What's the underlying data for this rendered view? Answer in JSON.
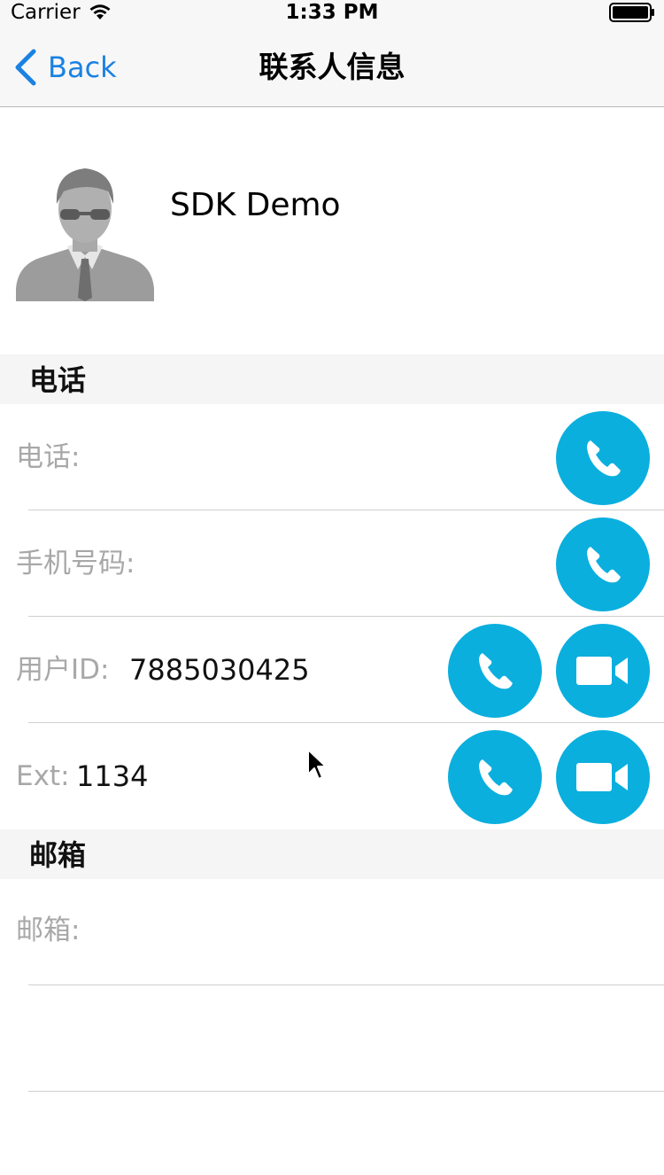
{
  "status_bar": {
    "carrier": "Carrier",
    "time": "1:33 PM"
  },
  "nav": {
    "back_label": "Back",
    "title": "联系人信息"
  },
  "profile": {
    "name": "SDK Demo",
    "avatar_icon": "person-avatar-icon"
  },
  "sections": {
    "phone_header": "电话",
    "email_header": "邮箱"
  },
  "rows": {
    "phone": {
      "label": "电话:",
      "value": ""
    },
    "mobile": {
      "label": "手机号码:",
      "value": ""
    },
    "user_id": {
      "label": "用户ID:",
      "value": "7885030425"
    },
    "ext": {
      "label": "Ext:",
      "value": "1134"
    },
    "email": {
      "label": "邮箱:",
      "value": ""
    }
  },
  "colors": {
    "accent": "#0aafde",
    "link": "#1a82e2"
  }
}
